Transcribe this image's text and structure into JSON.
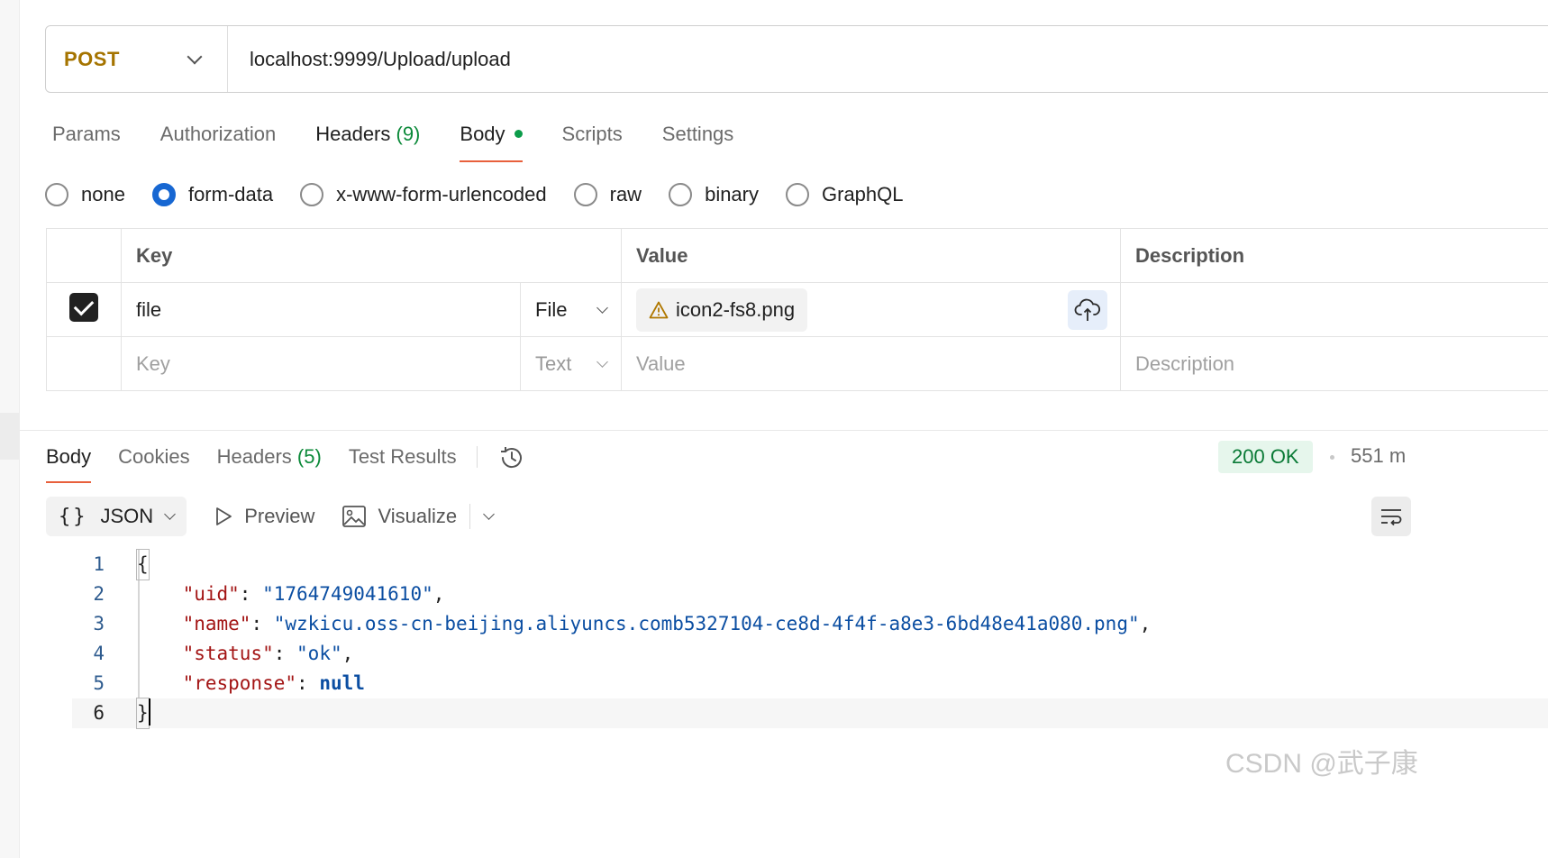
{
  "request": {
    "method": "POST",
    "url": "localhost:9999/Upload/upload"
  },
  "request_tabs": [
    {
      "label": "Params"
    },
    {
      "label": "Authorization"
    },
    {
      "label": "Headers",
      "count": "(9)"
    },
    {
      "label": "Body",
      "active": true
    },
    {
      "label": "Scripts"
    },
    {
      "label": "Settings"
    }
  ],
  "body_types": [
    {
      "label": "none",
      "selected": false
    },
    {
      "label": "form-data",
      "selected": true
    },
    {
      "label": "x-www-form-urlencoded",
      "selected": false
    },
    {
      "label": "raw",
      "selected": false
    },
    {
      "label": "binary",
      "selected": false
    },
    {
      "label": "GraphQL",
      "selected": false
    }
  ],
  "form_table": {
    "headers": {
      "key": "Key",
      "value": "Value",
      "description": "Description"
    },
    "rows": [
      {
        "checked": true,
        "key": "file",
        "type": "File",
        "value": "icon2-fs8.png",
        "description": ""
      }
    ],
    "placeholder_row": {
      "key": "Key",
      "type": "Text",
      "value": "Value",
      "description": "Description"
    }
  },
  "response_tabs": [
    {
      "label": "Body",
      "active": true
    },
    {
      "label": "Cookies"
    },
    {
      "label": "Headers",
      "count": "(5)"
    },
    {
      "label": "Test Results"
    }
  ],
  "response_status": {
    "code": "200 OK",
    "time": "551 m"
  },
  "format_bar": {
    "format": "JSON",
    "preview": "Preview",
    "visualize": "Visualize"
  },
  "code_lines": [
    {
      "n": "1"
    },
    {
      "n": "2"
    },
    {
      "n": "3"
    },
    {
      "n": "4"
    },
    {
      "n": "5"
    },
    {
      "n": "6"
    }
  ],
  "response_json": {
    "uid_key": "\"uid\"",
    "uid_val": "\"1764749041610\"",
    "name_key": "\"name\"",
    "name_val": "\"wzkicu.oss-cn-beijing.aliyuncs.comb5327104-ce8d-4f4f-a8e3-6bd48e41a080.png\"",
    "status_key": "\"status\"",
    "status_val": "\"ok\"",
    "response_key": "\"response\"",
    "response_val": "null"
  },
  "colors": {
    "accent": "#e8603c",
    "method": "#a57400",
    "status_ok": "#0a7a36",
    "radio_on": "#1767d2"
  },
  "watermark": "CSDN @武子康"
}
